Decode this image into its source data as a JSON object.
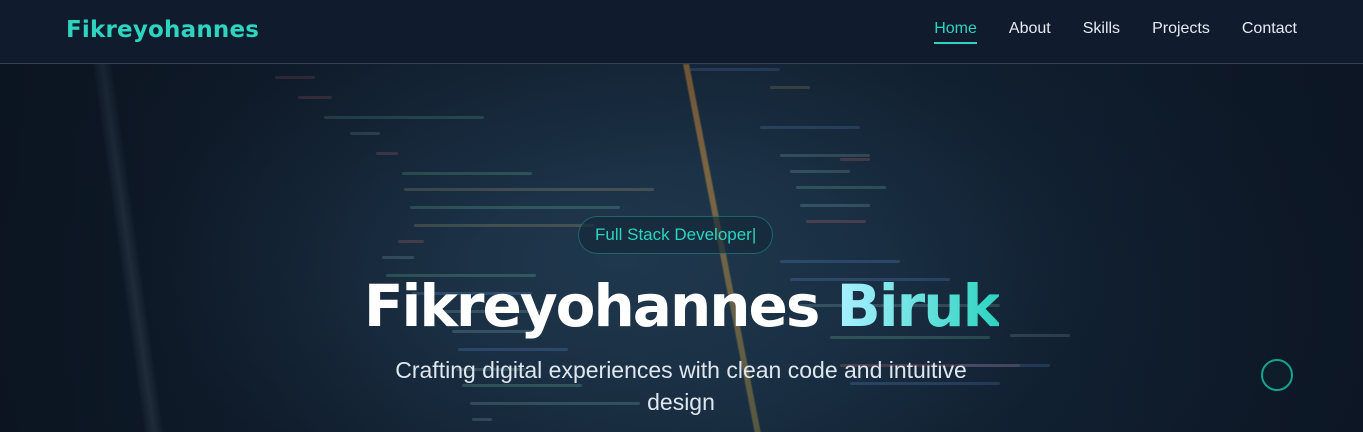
{
  "brand": {
    "name": "Fikreyohannes"
  },
  "nav": {
    "items": [
      {
        "label": "Home",
        "active": true
      },
      {
        "label": "About",
        "active": false
      },
      {
        "label": "Skills",
        "active": false
      },
      {
        "label": "Projects",
        "active": false
      },
      {
        "label": "Contact",
        "active": false
      }
    ]
  },
  "hero": {
    "badge": "Full Stack Developer|",
    "first_name": "Fikreyohannes",
    "last_name": "Biruk",
    "tagline": "Crafting digital experiences with clean code and intuitive design"
  },
  "colors": {
    "accent": "#2dd4bf",
    "nav_bg": "#101b2d",
    "text": "#e6ebf2"
  },
  "icons": {
    "scroll_indicator": "circle-outline-icon"
  }
}
